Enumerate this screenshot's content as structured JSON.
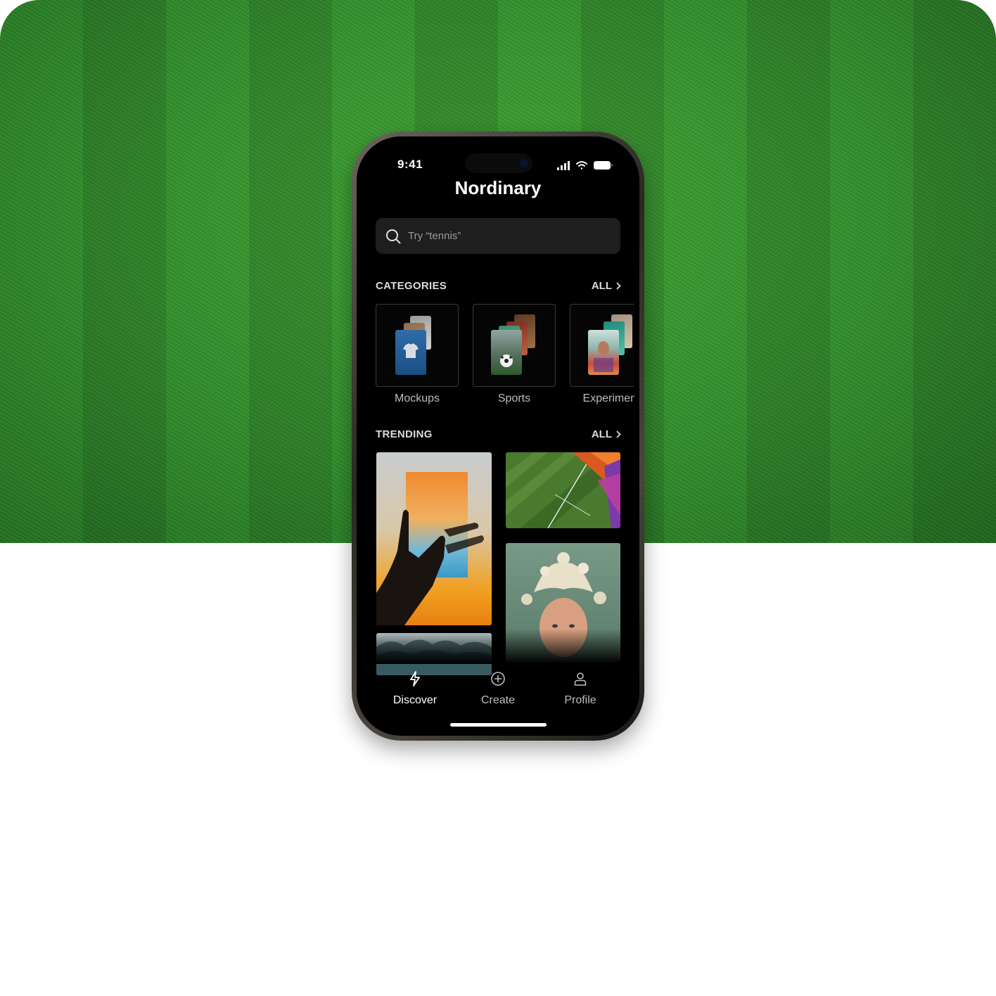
{
  "status_bar": {
    "time": "9:41"
  },
  "app": {
    "title": "Nordinary"
  },
  "search": {
    "placeholder": "Try “tennis”",
    "icon": "search-icon"
  },
  "categories": {
    "heading": "CATEGORIES",
    "all_label": "ALL",
    "items": [
      {
        "label": "Mockups",
        "icon": "tshirt-mockup-thumbnail"
      },
      {
        "label": "Sports",
        "icon": "soccer-ball-thumbnail"
      },
      {
        "label": "Experiment",
        "icon": "experimental-portrait-thumbnail"
      }
    ]
  },
  "trending": {
    "heading": "TRENDING",
    "all_label": "ALL",
    "items": [
      {
        "name": "hand-holding-gradient-card"
      },
      {
        "name": "aerial-tennis-court"
      },
      {
        "name": "portrait-with-butterfly-crown"
      },
      {
        "name": "ocean-waves"
      }
    ]
  },
  "tab_bar": {
    "items": [
      {
        "label": "Discover",
        "icon": "lightning-icon",
        "active": true
      },
      {
        "label": "Create",
        "icon": "plus-circle-icon",
        "active": false
      },
      {
        "label": "Profile",
        "icon": "person-icon",
        "active": false
      }
    ]
  },
  "colors": {
    "background": "#000000",
    "active_tab": "#ffffff",
    "inactive_tab": "#bdbdbd",
    "search_bg": "#1e1e1e",
    "grass": "#2f8a2a"
  }
}
